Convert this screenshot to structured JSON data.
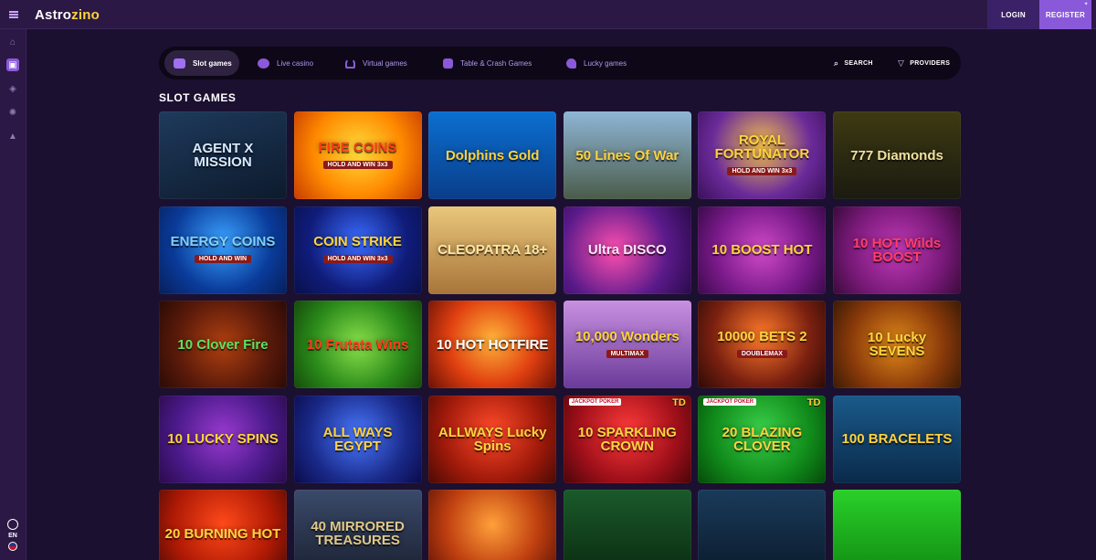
{
  "brand": {
    "logo_main": "Astro",
    "logo_accent": "zino",
    "accent_color": "#8a59d9"
  },
  "header": {
    "login_label": "LOGIN",
    "register_label": "REGISTER",
    "menu_icon": "hamburger-icon"
  },
  "sidebar": {
    "items": [
      {
        "icon": "home-icon",
        "glyph": "⌂"
      },
      {
        "icon": "slots-icon",
        "glyph": "▣"
      },
      {
        "icon": "sports-icon",
        "glyph": "◈"
      },
      {
        "icon": "settings-icon",
        "glyph": "✺"
      },
      {
        "icon": "promotions-icon",
        "glyph": "▲"
      }
    ],
    "language": "EN"
  },
  "categories": [
    {
      "label": "Slot games",
      "active": true,
      "icon": "slot-machine-icon"
    },
    {
      "label": "Live casino",
      "active": false,
      "icon": "live-casino-icon"
    },
    {
      "label": "Virtual games",
      "active": false,
      "icon": "horseshoe-icon"
    },
    {
      "label": "Table & Crash Games",
      "active": false,
      "icon": "dice-icon"
    },
    {
      "label": "Lucky games",
      "active": false,
      "icon": "clover-icon"
    }
  ],
  "tools": {
    "search_label": "SEARCH",
    "providers_label": "PROVIDERS"
  },
  "section_title": "SLOT GAMES",
  "games": [
    {
      "name": "AGENT X MISSION",
      "bg": "linear-gradient(160deg,#1e3a5c,#0d1a2c)",
      "color": "#d6e9ff"
    },
    {
      "name": "FIRE COINS",
      "bg": "radial-gradient(circle at 50% 45%,#ffdc3a,#ff8a00 55%,#c63b00)",
      "color": "#ff3b1a",
      "sub": "HOLD AND WIN 3x3"
    },
    {
      "name": "Dolphins Gold",
      "bg": "linear-gradient(180deg,#0b6fd0,#0a3d8a)",
      "color": "#ffd23d"
    },
    {
      "name": "50 Lines Of War",
      "bg": "linear-gradient(180deg,#8fb6d6,#4a5c4a)",
      "color": "#ffd23d"
    },
    {
      "name": "ROYAL FORTUNATOR",
      "bg": "radial-gradient(circle at 50% 40%,#f5c14b,#6b2b9a 60%,#3a0f5a)",
      "color": "#ffd23d",
      "sub": "HOLD AND WIN 3x3"
    },
    {
      "name": "777 Diamonds",
      "bg": "linear-gradient(180deg,#3e3a12,#1a1a10)",
      "color": "#f0dfa0"
    },
    {
      "name": "ENERGY COINS",
      "bg": "radial-gradient(circle at 50% 40%,#3aa2ff,#0a3b9a 60%,#061f5a)",
      "color": "#7fd0ff",
      "sub": "HOLD AND WIN"
    },
    {
      "name": "COIN STRIKE",
      "bg": "radial-gradient(circle at 50% 40%,#3a6cff,#101c7a 60%,#08104a)",
      "color": "#ffd23d",
      "sub": "HOLD AND WIN 3x3"
    },
    {
      "name": "CLEOPATRA 18+",
      "bg": "linear-gradient(180deg,#e9c77a,#a8743a)",
      "color": "#ffe6a0"
    },
    {
      "name": "Ultra DISCO",
      "bg": "radial-gradient(circle at 40% 50%,#ff4fb0,#5a1a8a 60%,#2a0a4a)",
      "color": "#ffe1ff"
    },
    {
      "name": "10 BOOST HOT",
      "bg": "radial-gradient(circle at 50% 50%,#d04ac8,#7a1a8a 60%,#3a0a4a)",
      "color": "#ffd23d"
    },
    {
      "name": "10 HOT Wilds BOOST",
      "bg": "radial-gradient(circle at 50% 50%,#c23ab8,#7a1a7a 60%,#3a0a3a)",
      "color": "#ff3b6a"
    },
    {
      "name": "10 Clover Fire",
      "bg": "radial-gradient(circle at 50% 50%,#b04010,#5a1a0a 60%,#2a0a05)",
      "color": "#5fe05f"
    },
    {
      "name": "10 Frutata Wins",
      "bg": "radial-gradient(circle at 50% 50%,#8ae04a,#2a8a1a 60%,#154a0a)",
      "color": "#ff3b1a"
    },
    {
      "name": "10 HOT HOTFIRE",
      "bg": "radial-gradient(circle at 50% 45%,#ffb43a,#e04010 55%,#6a1005)",
      "color": "#ffffff"
    },
    {
      "name": "10,000 Wonders",
      "bg": "linear-gradient(180deg,#c890e0,#6a3a9a)",
      "color": "#ffd23d",
      "sub": "MULTIMAX"
    },
    {
      "name": "10000 BETS 2",
      "bg": "radial-gradient(circle at 50% 40%,#ff7a2a,#7a2010 60%,#2a0a05)",
      "color": "#ffd23d",
      "sub": "DOUBLEMAX"
    },
    {
      "name": "10 Lucky SEVENS",
      "bg": "radial-gradient(circle at 50% 50%,#e08a1a,#8a3a0a 60%,#3a1a05)",
      "color": "#ffd23d"
    },
    {
      "name": "10 LUCKY SPINS",
      "bg": "radial-gradient(circle at 50% 45%,#9a3ad0,#4a1a8a 60%,#2a0a4a)",
      "color": "#ffd23d"
    },
    {
      "name": "ALL WAYS EGYPT",
      "bg": "radial-gradient(circle at 50% 45%,#4a7aff,#1a2a8a 60%,#0a0a4a)",
      "color": "#ffd23d"
    },
    {
      "name": "ALLWAYS Lucky Spins",
      "bg": "radial-gradient(circle at 50% 40%,#ff4a2a,#a01a0a 60%,#4a0a05)",
      "color": "#ffd23d"
    },
    {
      "name": "10 SPARKLING CROWN",
      "bg": "radial-gradient(circle at 50% 40%,#ff3a3a,#a0101a 60%,#4a050a)",
      "color": "#ffd23d",
      "td": "TD",
      "badge": "JACKPOT POKER"
    },
    {
      "name": "20 BLAZING CLOVER",
      "bg": "radial-gradient(circle at 50% 40%,#3ad04a,#108a1a 60%,#054a0a)",
      "color": "#ffd23d",
      "td": "TD",
      "badge": "JACKPOT POKER"
    },
    {
      "name": "100 BRACELETS",
      "bg": "linear-gradient(180deg,#1a5a8a,#0a2a4a)",
      "color": "#ffd23d"
    },
    {
      "name": "20 BURNING HOT",
      "bg": "radial-gradient(circle at 50% 40%,#ff4a1a,#b01a05 60%,#4a0a05)",
      "color": "#ffd23d"
    },
    {
      "name": "40 MIRRORED TREASURES",
      "bg": "linear-gradient(180deg,#3a4a6a,#1a2030)",
      "color": "#e0c88a"
    },
    {
      "name": "",
      "bg": "radial-gradient(circle at 50% 40%,#ffa03a,#c04010 55%,#5a1005)",
      "color": "#ffd23d"
    },
    {
      "name": "",
      "bg": "linear-gradient(180deg,#1a5a2a,#0a2a10)",
      "color": "#7aff7a"
    },
    {
      "name": "",
      "bg": "linear-gradient(180deg,#1a3a5a,#0a1a2a)",
      "color": "#7aff7a"
    },
    {
      "name": "",
      "bg": "linear-gradient(180deg,#2ad02a,#108a10)",
      "color": "#ffffff"
    }
  ]
}
